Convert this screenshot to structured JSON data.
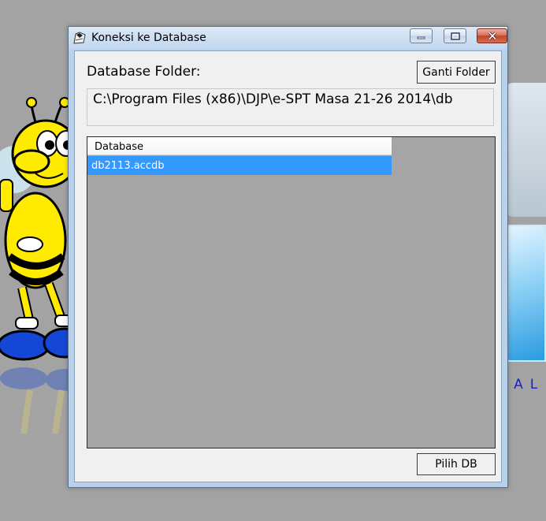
{
  "background": {
    "text": "SAL"
  },
  "window": {
    "title": "Koneksi ke Database",
    "icon": "app-icon"
  },
  "form": {
    "folder_label": "Database Folder:",
    "change_folder_button": "Ganti Folder",
    "folder_path": "C:\\Program Files (x86)\\DJP\\e-SPT Masa 21-26 2014\\db",
    "select_db_button": "Pilih DB"
  },
  "database_list": {
    "columns": [
      "Database"
    ],
    "rows": [
      {
        "name": "db2113.accdb",
        "selected": true
      }
    ]
  },
  "colors": {
    "selection": "#3399ff",
    "list_background": "#a5a5a5",
    "client_background": "#f0f0f0",
    "close_button": "#c5452c"
  }
}
